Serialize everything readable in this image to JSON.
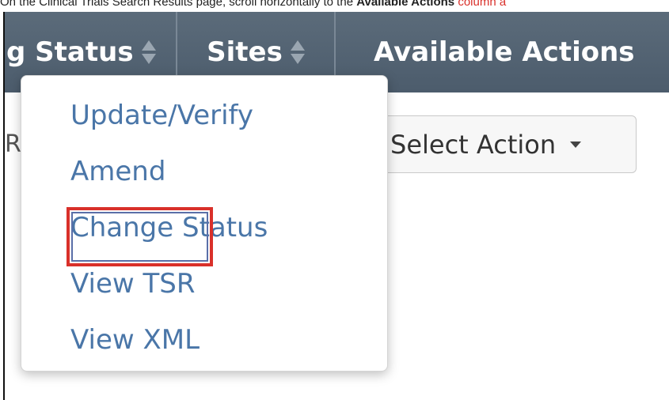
{
  "instruction": {
    "prefix": "On the Clinical Trials Search Results page, scroll horizontally to the ",
    "emphasis": "Available Actions",
    "suffix": " column a"
  },
  "table": {
    "columns": [
      {
        "label": "g Status"
      },
      {
        "label": "Sites"
      },
      {
        "label": "Available Actions"
      }
    ],
    "row_fragment": "R",
    "select_action_label": "Select Action"
  },
  "dropdown_menu": {
    "items": [
      {
        "label": "Update/Verify"
      },
      {
        "label": "Amend"
      },
      {
        "label": "Change Status"
      },
      {
        "label": "View TSR"
      },
      {
        "label": "View XML"
      }
    ],
    "highlighted_item": "Amend"
  },
  "colors": {
    "header_bg": "#53636f",
    "menu_link": "#4a76a8",
    "highlight": "#d9302a"
  }
}
